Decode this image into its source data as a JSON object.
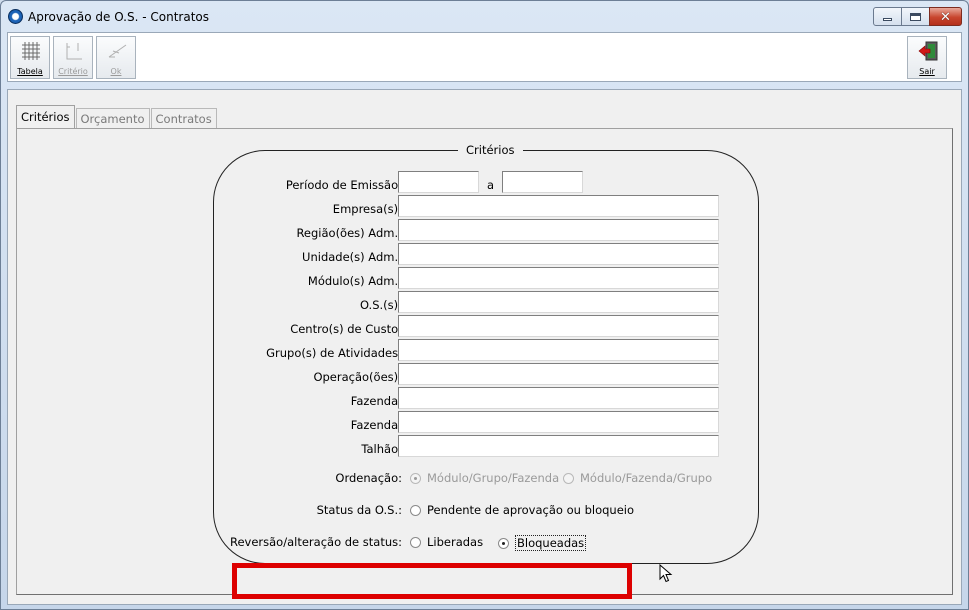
{
  "window": {
    "title": "Aprovação de O.S. - Contratos",
    "controls": {
      "minimize": "minimize",
      "maximize": "maximize",
      "close": "✕"
    }
  },
  "toolbar": {
    "buttons": [
      {
        "label": "Tabela",
        "icon": "grid-table-icon",
        "enabled": true
      },
      {
        "label": "Critério",
        "icon": "criteria-icon",
        "enabled": false
      },
      {
        "label": "Ok",
        "icon": "ok-check-icon",
        "enabled": false
      },
      {
        "label": "Sair",
        "icon": "exit-door-icon",
        "enabled": true
      }
    ]
  },
  "tabs": [
    {
      "label": "Critérios",
      "active": true
    },
    {
      "label": "Orçamento",
      "active": false
    },
    {
      "label": "Contratos",
      "active": false
    }
  ],
  "criteria": {
    "group_title": "Critérios",
    "periodo": {
      "label": "Período de Emissão:",
      "separator": "a",
      "start_value": "",
      "end_value": ""
    },
    "fields": [
      {
        "label": "Empresa(s):",
        "value": ""
      },
      {
        "label": "Região(ões) Adm.:",
        "value": ""
      },
      {
        "label": "Unidade(s) Adm.:",
        "value": ""
      },
      {
        "label": "Módulo(s) Adm.:",
        "value": ""
      },
      {
        "label": "O.S.(s):",
        "value": ""
      },
      {
        "label": "Centro(s) de Custo:",
        "value": ""
      },
      {
        "label": "Grupo(s) de Atividades:",
        "value": ""
      },
      {
        "label": "Operação(ões):",
        "value": ""
      },
      {
        "label": "Fazenda:",
        "value": ""
      },
      {
        "label": "Fazenda:",
        "value": ""
      },
      {
        "label": "Talhão:",
        "value": ""
      }
    ],
    "ordenacao": {
      "label": "Ordenação:",
      "options": [
        "Módulo/Grupo/Fazenda",
        "Módulo/Fazenda/Grupo"
      ],
      "selected": "Módulo/Grupo/Fazenda",
      "enabled": false
    },
    "status_os": {
      "label": "Status da O.S.:",
      "options": [
        "Pendente de aprovação ou bloqueio"
      ],
      "selected": ""
    },
    "reversao": {
      "label": "Reversão/alteração de status:",
      "options": [
        "Liberadas",
        "Bloqueadas"
      ],
      "selected": "Bloqueadas"
    }
  },
  "colors": {
    "highlight": "#dd0000",
    "title_bar": "#dbe7f5",
    "close_button": "#c8452e"
  }
}
